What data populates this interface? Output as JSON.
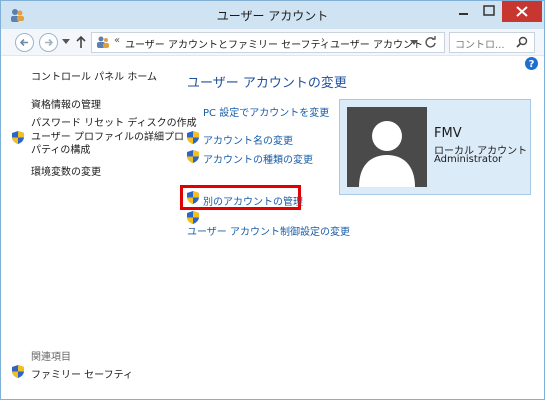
{
  "window": {
    "title": "ユーザー アカウント"
  },
  "address": {
    "overflow": "«",
    "crumbs": [
      "ユーザー アカウントとファミリー セーフティ",
      "ユーザー アカウント"
    ],
    "search_placeholder": "コントロ..."
  },
  "sidebar": {
    "home": "コントロール パネル ホーム",
    "links": [
      "資格情報の管理",
      "パスワード リセット ディスクの作成",
      "ユーザー プロファイルの詳細プロパティの構成",
      "環境変数の変更"
    ],
    "related_title": "関連項目",
    "related_links": [
      "ファミリー セーフティ"
    ]
  },
  "main": {
    "title": "ユーザー アカウントの変更",
    "tasks": [
      "PC 設定でアカウントを変更",
      "アカウント名の変更",
      "アカウントの種類の変更",
      "別のアカウントの管理",
      "ユーザー アカウント制御設定の変更"
    ]
  },
  "user_card": {
    "name": "FMV",
    "account_type": "ローカル アカウント",
    "role": "Administrator"
  },
  "colors": {
    "link": "#1a5ea8",
    "title": "#1e4f9c",
    "highlight": "#e10000",
    "card_bg": "#dcebf8",
    "titlebar": "#cfe3f3",
    "close_button": "#c7372f"
  },
  "icons": {
    "app": "user-accounts-icon",
    "shield": "uac-shield-icon",
    "help": "help-icon"
  }
}
